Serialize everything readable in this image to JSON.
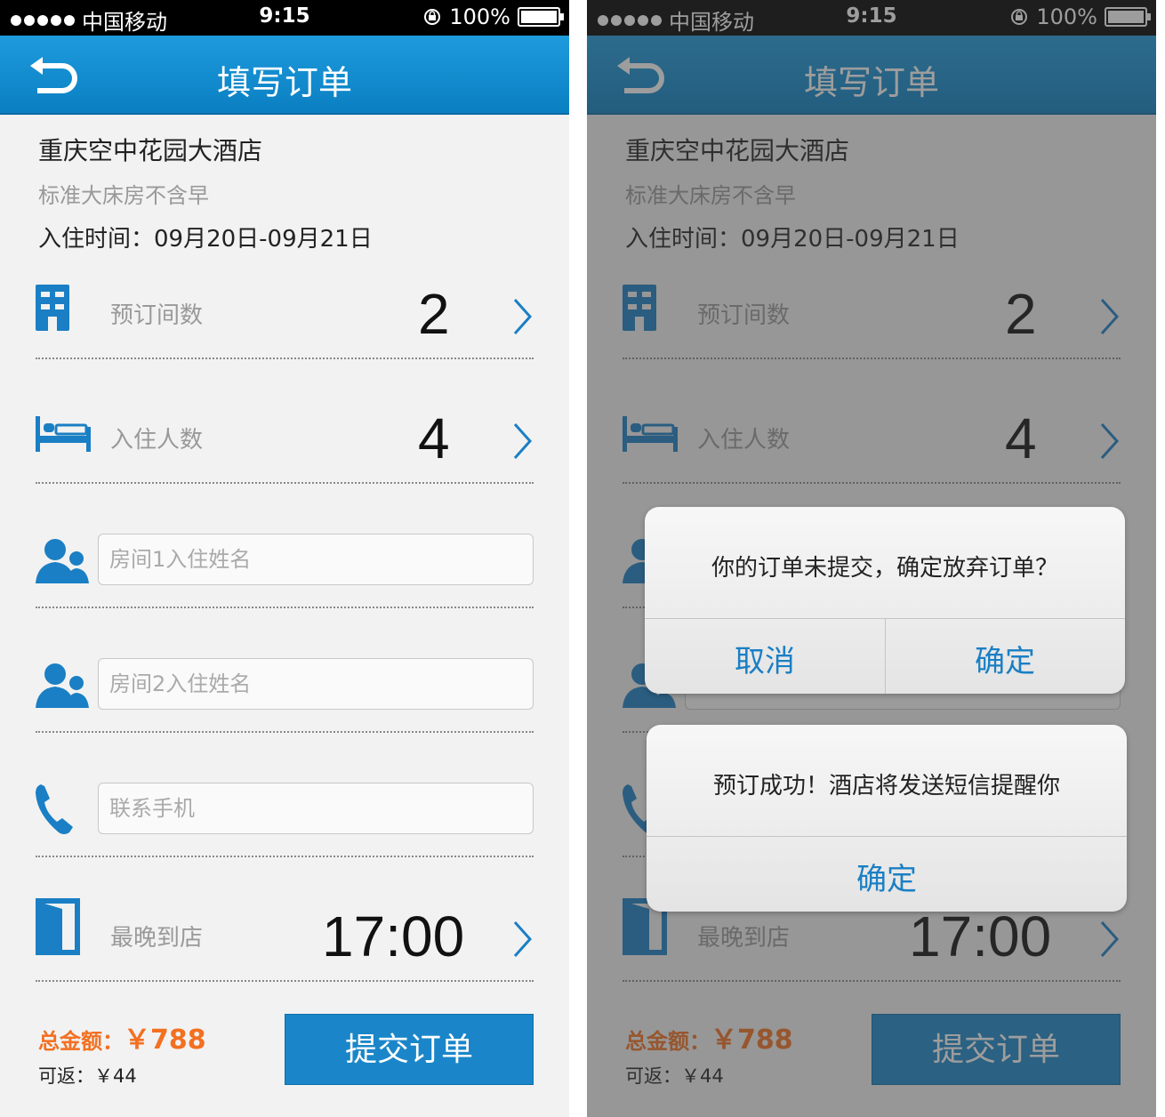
{
  "status_bar": {
    "carrier": "中国移动",
    "time": "9:15",
    "battery": "100%"
  },
  "nav": {
    "title": "填写订单"
  },
  "hotel": {
    "name": "重庆空中花园大酒店",
    "room_type": "标准大床房不含早",
    "checkin": "入住时间：09月20日-09月21日"
  },
  "form": {
    "rooms": {
      "label": "预订间数",
      "value": "2"
    },
    "guests": {
      "label": "入住人数",
      "value": "4"
    },
    "guest1": {
      "placeholder": "房间1入住姓名"
    },
    "guest2": {
      "placeholder": "房间2入住姓名"
    },
    "phone": {
      "placeholder": "联系手机"
    },
    "arrival": {
      "label": "最晚到店",
      "value": "17:00"
    }
  },
  "footer": {
    "total_label": "总金额：",
    "total_amount": "￥788",
    "rebate": "可返：￥44",
    "submit": "提交订单"
  },
  "alerts": {
    "abandon": {
      "message": "你的订单未提交，确定放弃订单？",
      "cancel": "取消",
      "confirm": "确定"
    },
    "success": {
      "message": "预订成功！酒店将发送短信提醒你",
      "confirm": "确定"
    }
  },
  "colors": {
    "accent": "#1a86c9",
    "navbar": "#0f8ace",
    "price": "#f37021",
    "alert_button": "#1a7fc4"
  },
  "icons": [
    "back-icon",
    "building-icon",
    "bed-icon",
    "person-icon",
    "phone-icon",
    "door-icon",
    "chevron-right-icon",
    "lock-rotation-icon",
    "battery-icon"
  ]
}
